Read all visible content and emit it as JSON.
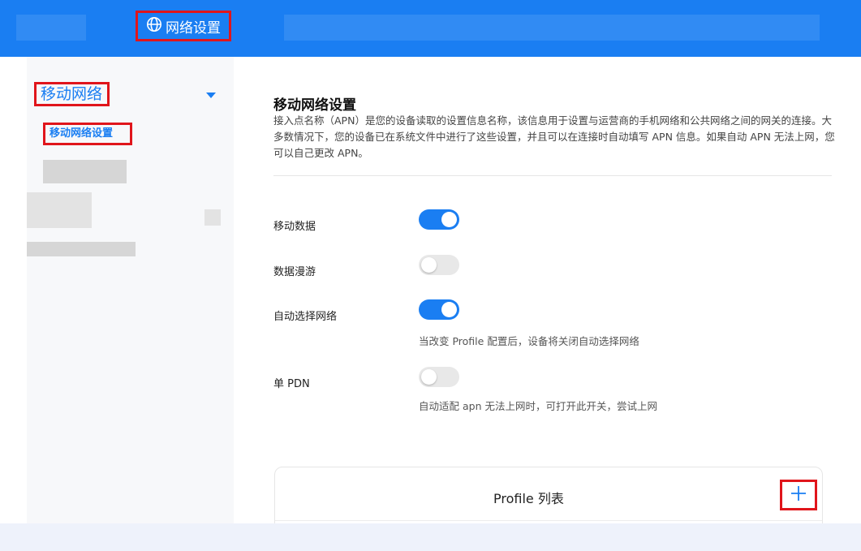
{
  "header": {
    "nav_label": "网络设置",
    "nav_icon": "globe-icon",
    "accent": "#1a7ef2"
  },
  "sidebar": {
    "group_label": "移动网络",
    "items": [
      {
        "label": "移动网络设置",
        "active": true
      }
    ]
  },
  "main": {
    "title": "移动网络设置",
    "description": "接入点名称（APN）是您的设备读取的设置信息名称，该信息用于设置与运营商的手机网络和公共网络之间的网关的连接。大多数情况下，您的设备已在系统文件中进行了这些设置，并且可以在连接时自动填写 APN 信息。如果自动 APN 无法上网，您可以自己更改 APN。",
    "settings": [
      {
        "label": "移动数据",
        "on": true,
        "hint": ""
      },
      {
        "label": "数据漫游",
        "on": false,
        "hint": ""
      },
      {
        "label": "自动选择网络",
        "on": true,
        "hint": "当改变 Profile 配置后，设备将关闭自动选择网络"
      },
      {
        "label": "单 PDN",
        "on": false,
        "hint": "自动适配 apn 无法上网时，可打开此开关，尝试上网"
      }
    ],
    "profile_list": {
      "title": "Profile 列表",
      "add_icon": "plus-icon"
    }
  }
}
